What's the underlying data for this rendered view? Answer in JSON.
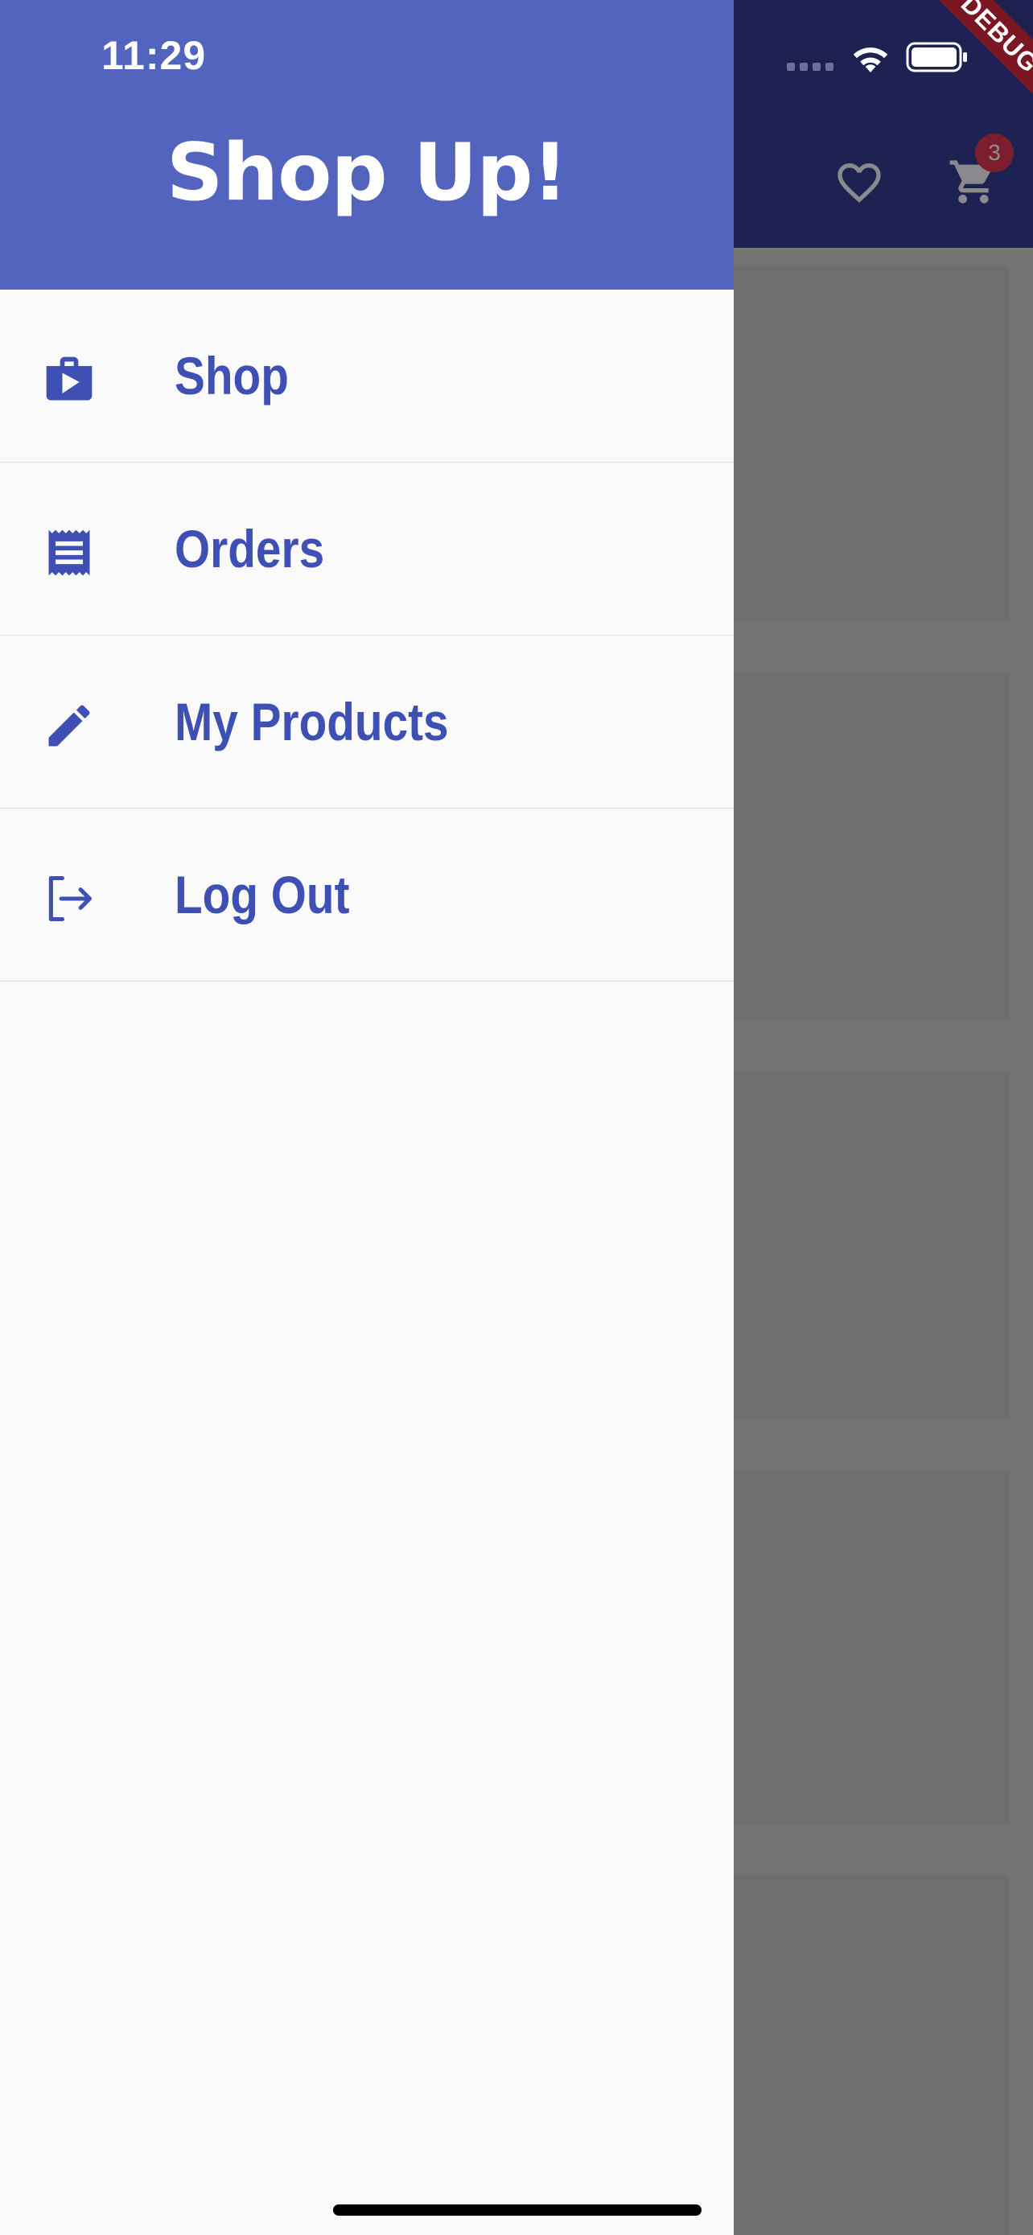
{
  "status_bar": {
    "time": "11:29"
  },
  "debug_banner": {
    "label": "DEBUG"
  },
  "background_app": {
    "cart_badge_count": "3"
  },
  "drawer": {
    "title": "Shop Up!",
    "items": [
      {
        "label": "Shop",
        "icon": "shop-icon"
      },
      {
        "label": "Orders",
        "icon": "receipt-icon"
      },
      {
        "label": "My Products",
        "icon": "edit-icon"
      },
      {
        "label": "Log Out",
        "icon": "logout-icon"
      }
    ]
  },
  "colors": {
    "drawer_header": "#5364bf",
    "accent": "#3f50b5",
    "app_bar": "#1d2253",
    "scrim": "#707173",
    "debug_ribbon": "#7b1722"
  }
}
